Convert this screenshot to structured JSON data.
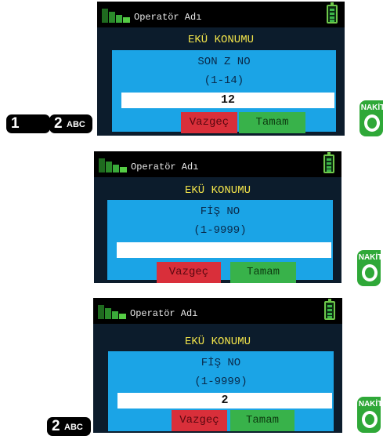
{
  "status_bar": {
    "operator_name": "Operatör Adı",
    "signal_icon": "signal-bars-icon",
    "battery_icon": "battery-icon"
  },
  "screens": [
    {
      "title": "EKÜ KONUMU",
      "prompt": "SON Z NO",
      "range": "(1-14)",
      "input_value": "12",
      "cancel_label": "Vazgeç",
      "ok_label": "Tamam"
    },
    {
      "title": "EKÜ KONUMU",
      "prompt": "FİŞ NO",
      "range": "(1-9999)",
      "input_value": "",
      "cancel_label": "Vazgeç",
      "ok_label": "Tamam"
    },
    {
      "title": "EKÜ KONUMU",
      "prompt": "FİŞ NO",
      "range": "(1-9999)",
      "input_value": "2",
      "cancel_label": "Vazgeç",
      "ok_label": "Tamam"
    }
  ],
  "keys": {
    "step1": [
      {
        "num": "1",
        "sub": ""
      },
      {
        "num": "2",
        "sub": "ABC"
      }
    ],
    "step3": [
      {
        "num": "2",
        "sub": "ABC"
      }
    ]
  },
  "nakit_key": {
    "label": "NAKİT",
    "icon": "zero-key-icon"
  },
  "colors": {
    "screen_bg": "#0c1c2c",
    "dialog_bg": "#1ba4e6",
    "title_yellow": "#f0e24a",
    "cancel_red": "#d92f3a",
    "ok_green": "#38b24a",
    "nakit_green": "#2fa838"
  }
}
